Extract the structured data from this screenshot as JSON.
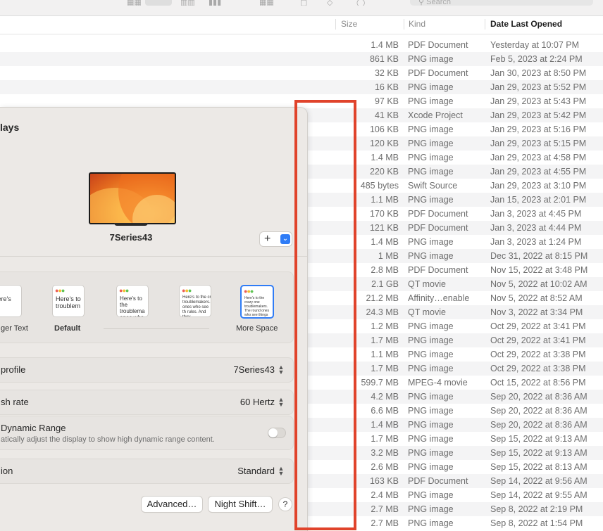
{
  "toolbar": {
    "search_placeholder": "Search"
  },
  "columns": {
    "size": "Size",
    "kind": "Kind",
    "date": "Date Last Opened"
  },
  "files": [
    {
      "size": "1.4 MB",
      "kind": "PDF Document",
      "date": "Yesterday at 10:07 PM"
    },
    {
      "size": "861 KB",
      "kind": "PNG image",
      "date": "Feb 5, 2023 at 2:24 PM"
    },
    {
      "size": "32 KB",
      "kind": "PDF Document",
      "date": "Jan 30, 2023 at 8:50 PM"
    },
    {
      "size": "16 KB",
      "kind": "PNG image",
      "date": "Jan 29, 2023 at 5:52 PM"
    },
    {
      "size": "97 KB",
      "kind": "PNG image",
      "date": "Jan 29, 2023 at 5:43 PM"
    },
    {
      "size": "41 KB",
      "kind": "Xcode Project",
      "date": "Jan 29, 2023 at 5:42 PM"
    },
    {
      "size": "106 KB",
      "kind": "PNG image",
      "date": "Jan 29, 2023 at 5:16 PM"
    },
    {
      "size": "120 KB",
      "kind": "PNG image",
      "date": "Jan 29, 2023 at 5:15 PM"
    },
    {
      "size": "1.4 MB",
      "kind": "PNG image",
      "date": "Jan 29, 2023 at 4:58 PM"
    },
    {
      "size": "220 KB",
      "kind": "PNG image",
      "date": "Jan 29, 2023 at 4:55 PM"
    },
    {
      "size": "485 bytes",
      "kind": "Swift Source",
      "date": "Jan 29, 2023 at 3:10 PM"
    },
    {
      "size": "1.1 MB",
      "kind": "PNG image",
      "date": "Jan 15, 2023 at 2:01 PM"
    },
    {
      "size": "170 KB",
      "kind": "PDF Document",
      "date": "Jan 3, 2023 at 4:45 PM"
    },
    {
      "size": "121 KB",
      "kind": "PDF Document",
      "date": "Jan 3, 2023 at 4:44 PM"
    },
    {
      "size": "1.4 MB",
      "kind": "PNG image",
      "date": "Jan 3, 2023 at 1:24 PM"
    },
    {
      "size": "1 MB",
      "kind": "PNG image",
      "date": "Dec 31, 2022 at 8:15 PM"
    },
    {
      "size": "2.8 MB",
      "kind": "PDF Document",
      "date": "Nov 15, 2022 at 3:48 PM"
    },
    {
      "size": "2.1 GB",
      "kind": "QT movie",
      "date": "Nov 5, 2022 at 10:02 AM"
    },
    {
      "size": "21.2 MB",
      "kind": "Affinity…enable",
      "date": "Nov 5, 2022 at 8:52 AM"
    },
    {
      "size": "24.3 MB",
      "kind": "QT movie",
      "date": "Nov 3, 2022 at 3:34 PM"
    },
    {
      "size": "1.2 MB",
      "kind": "PNG image",
      "date": "Oct 29, 2022 at 3:41 PM"
    },
    {
      "size": "1.7 MB",
      "kind": "PNG image",
      "date": "Oct 29, 2022 at 3:41 PM"
    },
    {
      "size": "1.1 MB",
      "kind": "PNG image",
      "date": "Oct 29, 2022 at 3:38 PM"
    },
    {
      "size": "1.7 MB",
      "kind": "PNG image",
      "date": "Oct 29, 2022 at 3:38 PM"
    },
    {
      "size": "599.7 MB",
      "kind": "MPEG-4 movie",
      "date": "Oct 15, 2022 at 8:56 PM"
    },
    {
      "size": "4.2 MB",
      "kind": "PNG image",
      "date": "Sep 20, 2022 at 8:36 AM"
    },
    {
      "size": "6.6 MB",
      "kind": "PNG image",
      "date": "Sep 20, 2022 at 8:36 AM"
    },
    {
      "size": "1.4 MB",
      "kind": "PNG image",
      "date": "Sep 20, 2022 at 8:36 AM"
    },
    {
      "size": "1.7 MB",
      "kind": "PNG image",
      "date": "Sep 15, 2022 at 9:13 AM"
    },
    {
      "size": "3.2 MB",
      "kind": "PNG image",
      "date": "Sep 15, 2022 at 9:13 AM"
    },
    {
      "size": "2.6 MB",
      "kind": "PNG image",
      "date": "Sep 15, 2022 at 8:13 AM"
    },
    {
      "size": "163 KB",
      "kind": "PDF Document",
      "date": "Sep 14, 2022 at 9:56 AM"
    },
    {
      "size": "2.4 MB",
      "kind": "PNG image",
      "date": "Sep 14, 2022 at 9:55 AM"
    },
    {
      "size": "2.7 MB",
      "kind": "PNG image",
      "date": "Sep 8, 2022 at 2:19 PM"
    },
    {
      "size": "2.7 MB",
      "kind": "PNG image",
      "date": "Sep 8, 2022 at 1:54 PM"
    }
  ],
  "displays": {
    "title": "lays",
    "monitor_name": "7Series43",
    "add_label": "+",
    "resolution": {
      "options": [
        {
          "preview": "Here's",
          "label": "ger Text"
        },
        {
          "preview": "Here's to troublem",
          "label": "Default"
        },
        {
          "preview": "Here's to the troublema ones who",
          "label": ""
        },
        {
          "preview": "Here's to the cr troublemakers. ones who see th rules. And they",
          "label": ""
        },
        {
          "preview": "Here's to the crazy one troublemakers. The round ones who see things diff",
          "label": "More Space"
        }
      ]
    },
    "color_profile": {
      "label": "profile",
      "value": "7Series43"
    },
    "refresh_rate": {
      "label": "sh rate",
      "value": "60 Hertz"
    },
    "hdr": {
      "label": "Dynamic Range",
      "sub": "atically adjust the display to show high dynamic range content.",
      "enabled": false
    },
    "rotation": {
      "label": "ion",
      "value": "Standard"
    },
    "buttons": {
      "advanced": "Advanced…",
      "night_shift": "Night Shift…",
      "help": "?"
    }
  },
  "highlight_color": "#e0432b",
  "accent_color": "#2f7cf6"
}
